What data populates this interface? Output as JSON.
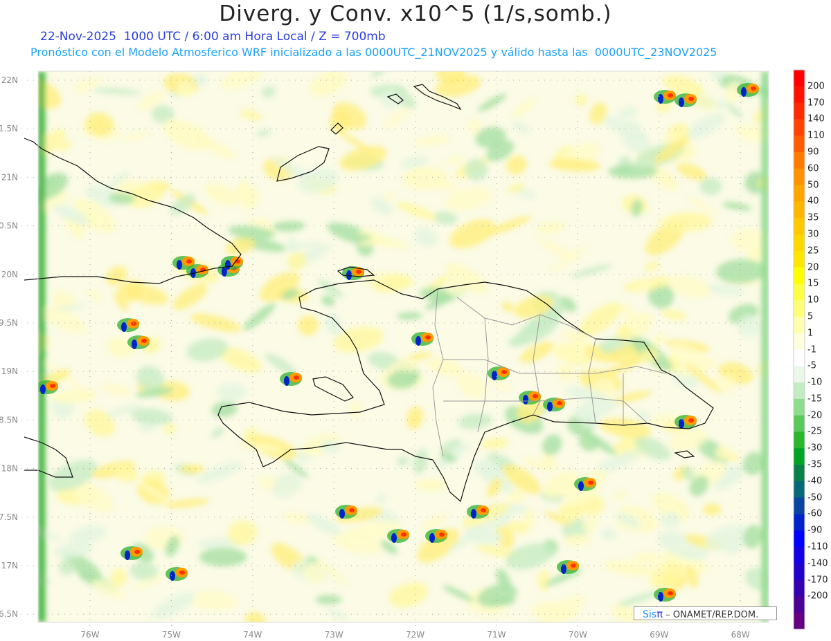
{
  "header": {
    "title": "Diverg. y Conv. x10^5 (1/s,somb.)",
    "subtitle_time": "22-Nov-2025  1000 UTC / 6:00 am Hora Local / Z = 700mb",
    "subtitle_model": "Pronóstico con el Modelo Atmosferico WRF inicializado a las 0000UTC_21NOV2025 y válido hasta las  0000UTC_23NOV2025"
  },
  "axes": {
    "lat_labels": [
      "22N",
      "1.5N",
      "21N",
      "0.5N",
      "20N",
      "9.5N",
      "19N",
      "8.5N",
      "18N",
      "7.5N",
      "17N",
      "6.5N"
    ],
    "lon_labels": [
      "76W",
      "75W",
      "74W",
      "73W",
      "72W",
      "71W",
      "70W",
      "69W",
      "68W"
    ]
  },
  "colorbar": {
    "labels": [
      "200",
      "170",
      "140",
      "110",
      "90",
      "60",
      "50",
      "40",
      "35",
      "30",
      "25",
      "20",
      "15",
      "10",
      "5",
      "1",
      "-1",
      "-5",
      "-10",
      "-15",
      "-20",
      "-25",
      "-30",
      "-35",
      "-40",
      "-50",
      "-60",
      "-90",
      "-110",
      "-140",
      "-170",
      "-200"
    ],
    "colors": [
      "#ff0000",
      "#ff1200",
      "#ff2a00",
      "#ff4400",
      "#ff5e00",
      "#ff7a00",
      "#ff9200",
      "#ffa600",
      "#ffb600",
      "#ffc800",
      "#ffd800",
      "#ffe600",
      "#ffff00",
      "#ffff44",
      "#ffff78",
      "#ffffb0",
      "#ffffe0",
      "#ffffff",
      "#eaf8ea",
      "#c2ecc2",
      "#8edc8e",
      "#5ac85a",
      "#2cb62c",
      "#00a424",
      "#088048",
      "#066878",
      "#0a44a0",
      "#0022c8",
      "#0000ff",
      "#1400e6",
      "#2200cc",
      "#3400b0",
      "#4c0094",
      "#640080"
    ]
  },
  "credit": {
    "sis": "Sis",
    "pi": "π",
    "rest": " – ONAMET/REP.DOM."
  }
}
